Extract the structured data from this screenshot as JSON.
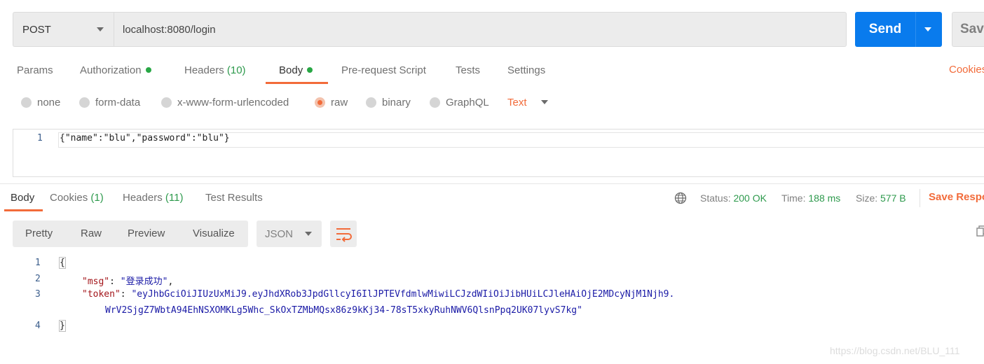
{
  "request": {
    "method": "POST",
    "url": "localhost:8080/login",
    "send_label": "Send",
    "save_label": "Save"
  },
  "request_tabs": {
    "params": "Params",
    "authorization": "Authorization",
    "headers": "Headers",
    "headers_count": "(10)",
    "body": "Body",
    "pre_request": "Pre-request Script",
    "tests": "Tests",
    "settings": "Settings",
    "cookies": "Cookies",
    "active": "Body"
  },
  "body_types": {
    "none": "none",
    "form_data": "form-data",
    "urlencoded": "x-www-form-urlencoded",
    "raw": "raw",
    "binary": "binary",
    "graphql": "GraphQL",
    "selected": "raw",
    "format": "Text"
  },
  "request_body": {
    "line_numbers": [
      "1"
    ],
    "lines": [
      "{\"name\":\"blu\",\"password\":\"blu\"}"
    ]
  },
  "response_tabs": {
    "body": "Body",
    "cookies": "Cookies",
    "cookies_count": "(1)",
    "headers": "Headers",
    "headers_count": "(11)",
    "test_results": "Test Results",
    "active": "Body"
  },
  "response_meta": {
    "status_label": "Status:",
    "status_value": "200 OK",
    "time_label": "Time:",
    "time_value": "188 ms",
    "size_label": "Size:",
    "size_value": "577 B",
    "save_response": "Save Response"
  },
  "view_modes": {
    "pretty": "Pretty",
    "raw": "Raw",
    "preview": "Preview",
    "visualize": "Visualize",
    "format": "JSON",
    "active": "Pretty"
  },
  "response_body": {
    "line_numbers": [
      "1",
      "2",
      "3",
      "4"
    ],
    "open_brace": "{",
    "close_brace": "}",
    "msg_key": "\"msg\"",
    "msg_value": "\"登录成功\"",
    "token_key": "\"token\"",
    "token_value_line1": "\"eyJhbGciOiJIUzUxMiJ9.eyJhdXRob3JpdGllcyI6IlJPTEVfdmlwMiwiLCJzdWIiOiJibHUiLCJleHAiOjE2MDcyNjM1Njh9.",
    "token_value_line2": "WrV2SjgZ7WbtA94EhNSXOMKLg5Whc_SkOxTZMbMQsx86z9kKj34-78sT5xkyRuhNWV6QlsnPpq2UK07lyvS7kg\""
  },
  "watermark": "https://blog.csdn.net/BLU_111",
  "colors": {
    "accent": "#f26b3a",
    "send_button": "#097bed",
    "success": "#2e9a4d"
  }
}
